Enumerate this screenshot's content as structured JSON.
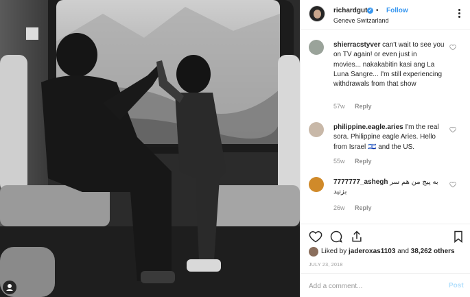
{
  "post": {
    "username": "richardgutz",
    "verified": true,
    "separator": "•",
    "follow_label": "Follow",
    "location": "Geneve Switzarland"
  },
  "comments": [
    {
      "username": "shierracstyver",
      "text": "can't wait to see you on TV again! or even just in movies... nakakabitin kasi ang La Luna Sangre... I'm still experiencing withdrawals from that show",
      "age": "57w",
      "reply_label": "Reply",
      "avatar_color": "#9aa39a"
    },
    {
      "username": "philippine.eagle.aries",
      "text": "I'm the real sora. Philippine eagle Aries. Hello from Israel 🇮🇱 and the US.",
      "age": "55w",
      "reply_label": "Reply",
      "avatar_color": "#c8b8a8"
    },
    {
      "username": "7777777_ashegh",
      "text": "به پیج من هم سر بزنید",
      "age": "26w",
      "reply_label": "Reply",
      "avatar_color": "#d08a2a"
    }
  ],
  "actions": {
    "like_icon": "heart-icon",
    "comment_icon": "comment-icon",
    "share_icon": "share-icon",
    "save_icon": "bookmark-icon"
  },
  "likes": {
    "prefix": "Liked by",
    "user": "jaderoxas1103",
    "middle": "and",
    "count": "38,262 others"
  },
  "date": "JULY 23, 2018",
  "add_comment": {
    "placeholder": "Add a comment...",
    "post_label": "Post"
  },
  "colors": {
    "accent": "#3897f0",
    "text": "#262626",
    "muted": "#8e8e8e",
    "border": "#efefef"
  }
}
